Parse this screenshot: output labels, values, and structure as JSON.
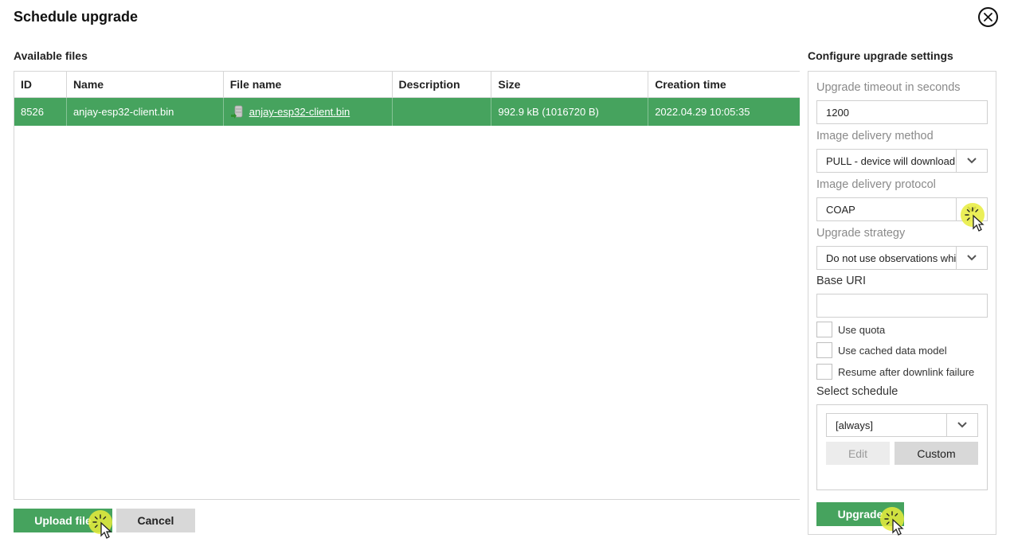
{
  "dialog": {
    "title": "Schedule upgrade"
  },
  "files": {
    "section_label": "Available files",
    "columns": [
      "ID",
      "Name",
      "File name",
      "Description",
      "Size",
      "Creation time"
    ],
    "rows": [
      {
        "id": "8526",
        "name": "anjay-esp32-client.bin",
        "file_name": "anjay-esp32-client.bin",
        "description": "",
        "size": "992.9 kB (1016720 B)",
        "creation_time": "2022.04.29 10:05:35"
      }
    ]
  },
  "actions": {
    "upload_label": "Upload file",
    "cancel_label": "Cancel"
  },
  "settings": {
    "section_label": "Configure upgrade settings",
    "timeout_label": "Upgrade timeout in seconds",
    "timeout_value": "1200",
    "delivery_method_label": "Image delivery method",
    "delivery_method_value": "PULL - device will download",
    "delivery_protocol_label": "Image delivery protocol",
    "delivery_protocol_value": "COAP",
    "strategy_label": "Upgrade strategy",
    "strategy_value": "Do not use observations while",
    "base_uri_label": "Base URI",
    "base_uri_value": "",
    "checkboxes": [
      "Use quota",
      "Use cached data model",
      "Resume after downlink failure"
    ],
    "schedule_label": "Select schedule",
    "schedule_value": "[always]",
    "edit_label": "Edit",
    "custom_label": "Custom",
    "upgrade_label": "Upgrade"
  },
  "colors": {
    "accent": "#46a35e",
    "highlight": "#e8ec3b"
  }
}
